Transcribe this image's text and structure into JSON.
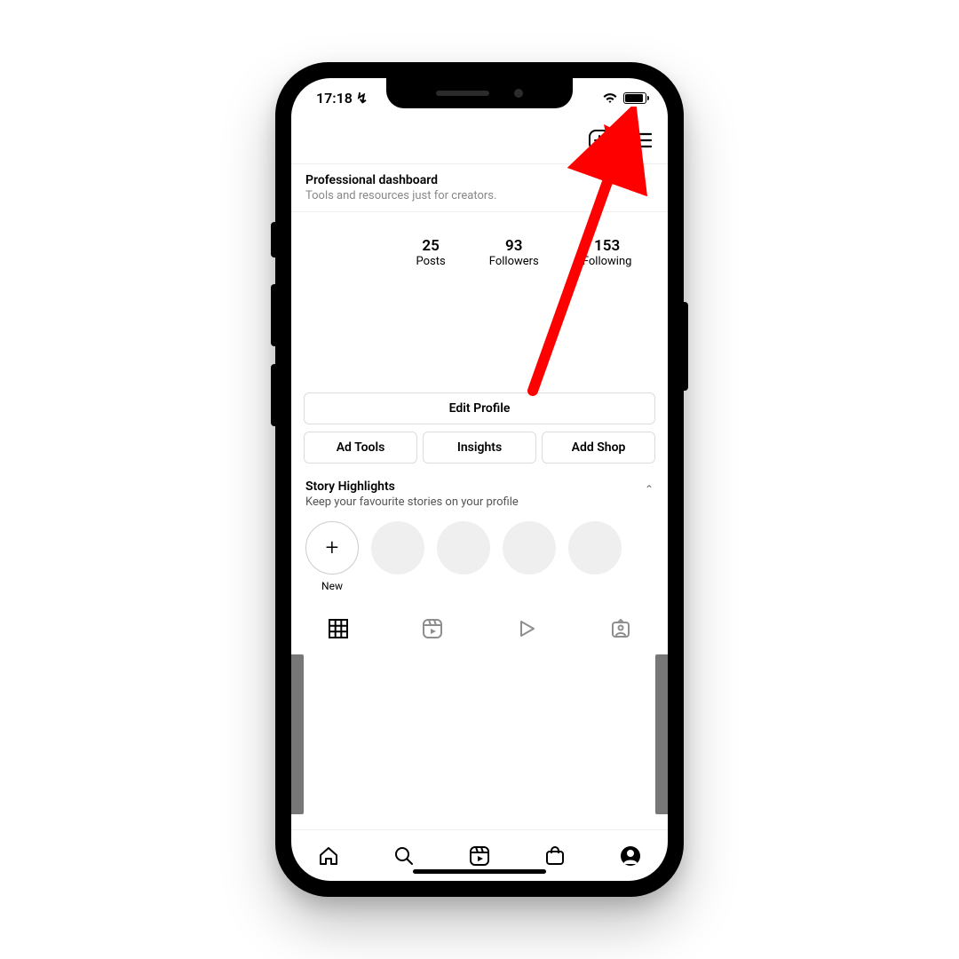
{
  "statusbar": {
    "time": "17:18 ↯"
  },
  "topnav": {
    "create_icon": "create-post-icon",
    "menu_icon": "hamburger-icon"
  },
  "dashboard": {
    "title": "Professional dashboard",
    "subtitle": "Tools and resources just for creators."
  },
  "stats": {
    "posts": {
      "count": "25",
      "label": "Posts"
    },
    "followers": {
      "count": "93",
      "label": "Followers"
    },
    "following": {
      "count": "153",
      "label": "Following"
    }
  },
  "buttons": {
    "edit": "Edit Profile",
    "ad_tools": "Ad Tools",
    "insights": "Insights",
    "add_shop": "Add Shop"
  },
  "highlights": {
    "title": "Story Highlights",
    "subtitle": "Keep your favourite stories on your profile",
    "new_label": "New"
  },
  "content_tabs": [
    "grid",
    "reels",
    "play",
    "tagged"
  ],
  "bottombar": [
    "home",
    "search",
    "reels",
    "shop",
    "profile"
  ],
  "annotation": {
    "color": "#ff0000"
  }
}
